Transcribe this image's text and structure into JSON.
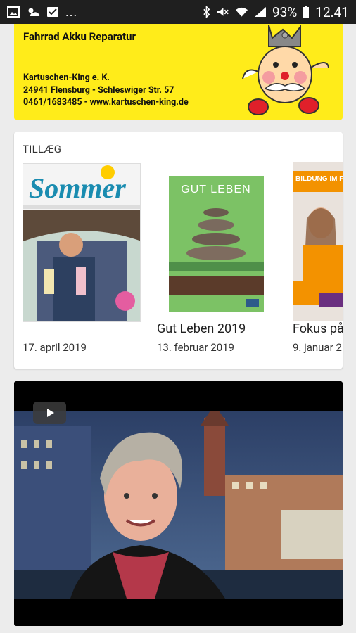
{
  "status_bar": {
    "battery_percent": "93%",
    "time": "12.41",
    "overflow": "..."
  },
  "ad": {
    "title": "Fahrrad Akku Reparatur",
    "company": "Kartuschen-King e. K.",
    "address": "24941  Flensburg  -  Schleswiger  Str.  57",
    "contact": "0461/1683485 - www.kartuschen-king.de"
  },
  "supplements": {
    "section_label": "TILLÆG",
    "items": [
      {
        "title": "",
        "date": "17. april 2019",
        "cover_text": "Sommer"
      },
      {
        "title": "Gut Leben 2019",
        "date": "13. februar 2019",
        "cover_text": "GUT LEBEN"
      },
      {
        "title": "Fokus på",
        "date": "9. januar 2",
        "cover_text": "BILDUNG IM FOKUS"
      }
    ]
  },
  "video": {
    "play_icon": "play-icon"
  }
}
